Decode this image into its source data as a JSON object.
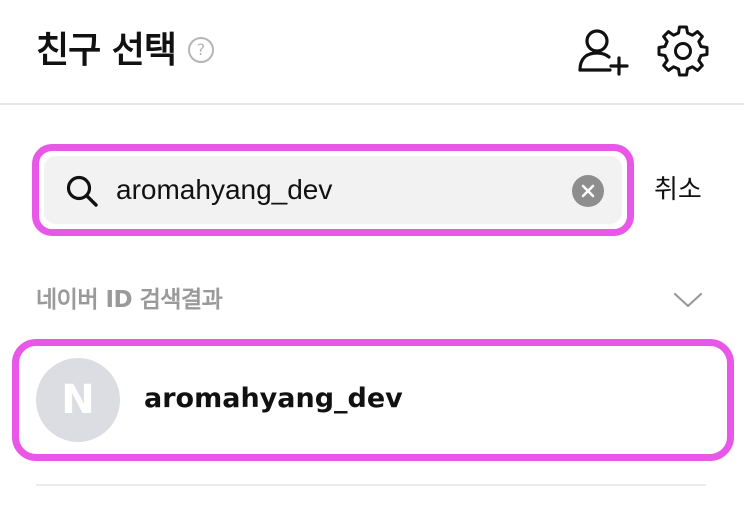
{
  "header": {
    "title": "친구 선택",
    "help_icon": "question-circle-icon",
    "add_friend_icon": "person-plus-icon",
    "settings_icon": "gear-icon"
  },
  "search": {
    "value": "aromahyang_dev",
    "search_icon": "magnifier-icon",
    "clear_icon": "clear-x-circle-icon",
    "cancel_label": "취소"
  },
  "results": {
    "section_title": "네이버 ID 검색결과",
    "collapse_icon": "chevron-down-icon",
    "items": [
      {
        "avatar_letter": "N",
        "name": "aromahyang_dev"
      }
    ]
  },
  "colors": {
    "highlight": "#e857e8",
    "search_bg": "#f2f2f2",
    "muted_text": "#9a9a9a",
    "avatar_bg": "#dcdde2"
  }
}
